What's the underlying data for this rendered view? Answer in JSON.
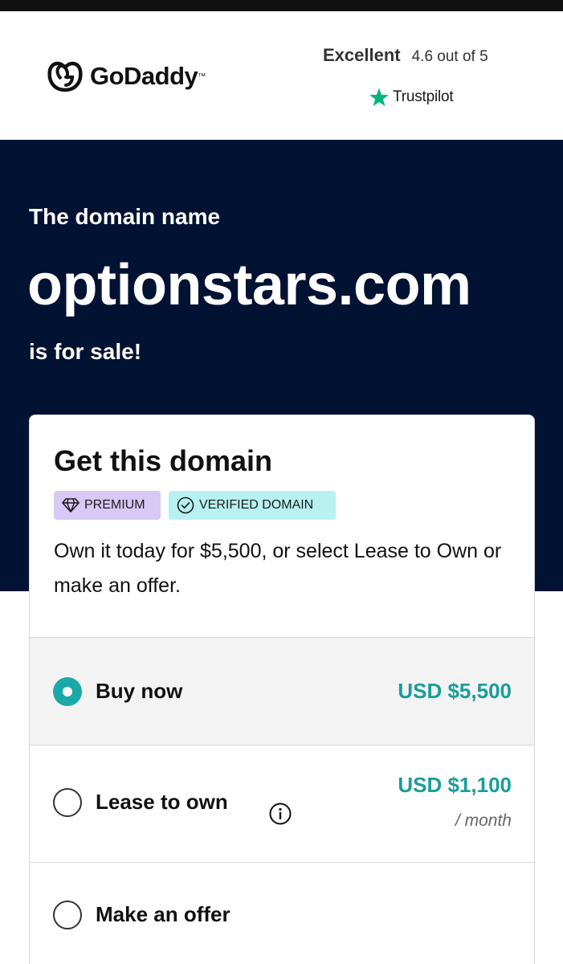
{
  "header": {
    "logo_text": "GoDaddy",
    "logo_icon": "godaddy-logo-icon",
    "rating_word": "Excellent",
    "rating_score": "4.6 out of 5",
    "trustpilot_label": "Trustpilot",
    "trustpilot_icon": "trustpilot-star-icon",
    "trustpilot_color": "#00b67a"
  },
  "hero": {
    "pre_text": "The domain name",
    "domain": "optionstars.com",
    "post_text": "is for sale!",
    "background": "#021232"
  },
  "card": {
    "title": "Get this domain",
    "badges": [
      {
        "label": "PREMIUM",
        "icon": "diamond-icon",
        "color": "#d7c8f4"
      },
      {
        "label": "VERIFIED DOMAIN",
        "icon": "check-circle-icon",
        "color": "#b7f1f2"
      }
    ],
    "description": "Own it today for $5,500, or select Lease to Own or make an offer.",
    "options": [
      {
        "label": "Buy now",
        "price": "USD $5,500",
        "selected": true
      },
      {
        "label": "Lease to own",
        "price": "USD $1,100",
        "per": "/ month",
        "icon": "info-icon",
        "selected": false
      },
      {
        "label": "Make an offer",
        "selected": false
      }
    ],
    "accent_color": "#1ba8a8"
  }
}
